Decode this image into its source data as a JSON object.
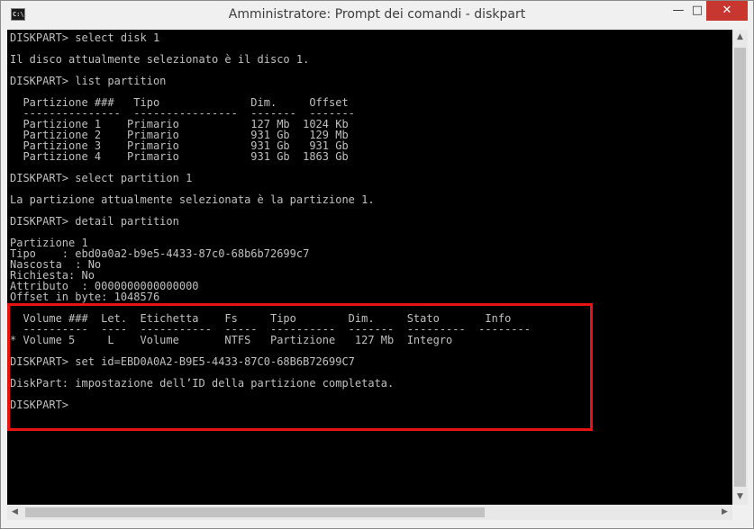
{
  "window": {
    "title": "Amministratore: Prompt dei comandi - diskpart",
    "icon": "console-icon",
    "icon_text": "C:\\.",
    "controls": {
      "minimize": "—",
      "maximize": "□",
      "close": "✕"
    }
  },
  "console": {
    "lines": [
      "DISKPART> select disk 1",
      "",
      "Il disco attualmente selezionato è il disco 1.",
      "",
      "DISKPART> list partition",
      "",
      "  Partizione ###   Tipo              Dim.     Offset",
      "  ---------------  ----------------  -------  -------",
      "  Partizione 1    Primario           127 Mb  1024 Kb",
      "  Partizione 2    Primario           931 Gb   129 Mb",
      "  Partizione 3    Primario           931 Gb   931 Gb",
      "  Partizione 4    Primario           931 Gb  1863 Gb",
      "",
      "DISKPART> select partition 1",
      "",
      "La partizione attualmente selezionata è la partizione 1.",
      "",
      "DISKPART> detail partition",
      "",
      "Partizione 1",
      "Tipo    : ebd0a0a2-b9e5-4433-87c0-68b6b72699c7",
      "Nascosta  : No",
      "Richiesta: No",
      "Attributo  : 0000000000000000",
      "Offset in byte: 1048576",
      "",
      "  Volume ###  Let.  Etichetta    Fs     Tipo        Dim.     Stato       Info",
      "  ----------  ----  -----------  -----  ----------  -------  ---------  --------",
      "* Volume 5     L    Volume       NTFS   Partizione   127 Mb  Integro",
      "",
      "DISKPART> set id=EBD0A0A2-B9E5-4433-87C0-68B6B72699C7",
      "",
      "DiskPart: impostazione dell’ID della partizione completata.",
      "",
      "DISKPART> "
    ]
  },
  "colors": {
    "console_bg": "#000000",
    "console_text": "#c0c0c0",
    "highlight_border": "#e81313",
    "close_button": "#c7372f"
  },
  "scrollbars": {
    "up": "▲",
    "down": "▼",
    "left": "◀",
    "right": "▶"
  }
}
